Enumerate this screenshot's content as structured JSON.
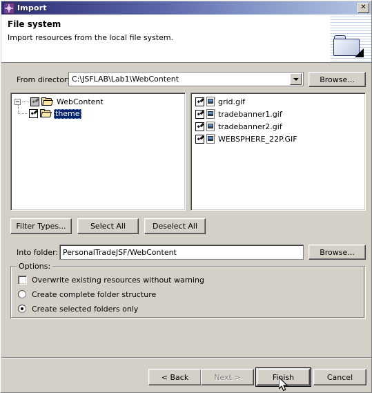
{
  "window": {
    "title": "Import",
    "icon": "import-wizard-icon",
    "close_label": "✕"
  },
  "header": {
    "title": "File system",
    "subtitle": "Import resources from the local file system.",
    "graphic": "folder-banner-icon"
  },
  "from_directory": {
    "label": "From directory:",
    "value": "C:\\JSFLAB\\Lab1\\WebContent",
    "dropdown_icon": "chevron-down-icon",
    "browse_label": "Browse..."
  },
  "tree": {
    "nodes": [
      {
        "label": "WebContent",
        "checkbox_state": "partial",
        "expanded": true,
        "selected": false,
        "icon": "folder-icon"
      },
      {
        "label": "theme",
        "checkbox_state": "checked",
        "expanded": false,
        "selected": true,
        "icon": "folder-icon"
      }
    ]
  },
  "file_list": {
    "items": [
      {
        "label": "grid.gif",
        "checked": true,
        "icon": "image-file-icon"
      },
      {
        "label": "tradebanner1.gif",
        "checked": true,
        "icon": "image-file-icon"
      },
      {
        "label": "tradebanner2.gif",
        "checked": true,
        "icon": "image-file-icon"
      },
      {
        "label": "WEBSPHERE_22P.GIF",
        "checked": true,
        "icon": "image-file-icon"
      }
    ]
  },
  "selection_buttons": {
    "filter_types": "Filter Types...",
    "select_all": "Select All",
    "deselect_all": "Deselect All"
  },
  "into_folder": {
    "label": "Into folder:",
    "value": "PersonalTradeJSF/WebContent",
    "browse_label": "Browse..."
  },
  "options": {
    "legend": "Options:",
    "overwrite": {
      "label": "Overwrite existing resources without warning",
      "checked": false
    },
    "create_complete": {
      "label": "Create complete folder structure",
      "selected": false
    },
    "create_selected": {
      "label": "Create selected folders only",
      "selected": true
    }
  },
  "footer": {
    "back": "< Back",
    "next": "Next >",
    "next_disabled": true,
    "finish": "Finish",
    "finish_default": true,
    "cancel": "Cancel"
  },
  "colors": {
    "dialog_face": "#d4d0c8",
    "titlebar_left": "#2b2f6e",
    "titlebar_right": "#b6c6e4",
    "selection_blue": "#0a246a",
    "folder_yellow": "#f5d88a",
    "disabled_text": "#808080"
  }
}
